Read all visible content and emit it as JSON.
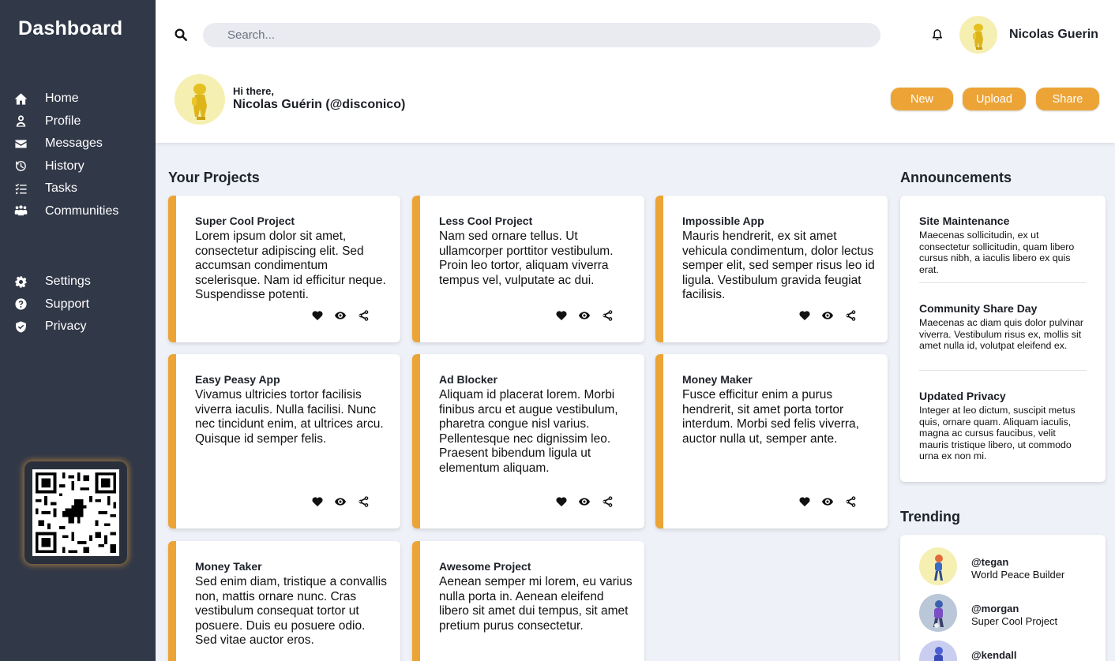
{
  "sidebar": {
    "brand": "Dashboard",
    "primary": [
      {
        "label": "Home",
        "icon": "home-icon"
      },
      {
        "label": "Profile",
        "icon": "profile-icon"
      },
      {
        "label": "Messages",
        "icon": "envelope-icon"
      },
      {
        "label": "History",
        "icon": "history-icon"
      },
      {
        "label": "Tasks",
        "icon": "tasks-icon"
      },
      {
        "label": "Communities",
        "icon": "users-icon"
      }
    ],
    "secondary": [
      {
        "label": "Settings",
        "icon": "gear-icon"
      },
      {
        "label": "Support",
        "icon": "question-icon"
      },
      {
        "label": "Privacy",
        "icon": "shield-icon"
      }
    ]
  },
  "header": {
    "search_placeholder": "Search...",
    "user_name": "Nicolas Guerin",
    "greeting": "Hi there,",
    "full_name": "Nicolas Guérin (@disconico)",
    "buttons": {
      "new": "New",
      "upload": "Upload",
      "share": "Share"
    }
  },
  "projects": {
    "title": "Your Projects",
    "items": [
      {
        "name": "Super Cool Project",
        "desc": "Lorem ipsum dolor sit amet, consectetur adipiscing elit. Sed accumsan condimentum scelerisque. Nam id efficitur neque. Suspendisse potenti."
      },
      {
        "name": "Less Cool Project",
        "desc": "Nam sed ornare tellus. Ut ullamcorper porttitor vestibulum. Proin leo tortor, aliquam viverra tempus vel, vulputate ac dui."
      },
      {
        "name": "Impossible App",
        "desc": "Mauris hendrerit, ex sit amet vehicula condimentum, dolor lectus semper elit, sed semper risus leo id ligula. Vestibulum gravida feugiat facilisis."
      },
      {
        "name": "Easy Peasy App",
        "desc": "Vivamus ultricies tortor facilisis viverra iaculis. Nulla facilisi. Nunc nec tincidunt enim, at ultrices arcu. Quisque id semper felis."
      },
      {
        "name": "Ad Blocker",
        "desc": "Aliquam id placerat lorem. Morbi finibus arcu et augue vestibulum, pharetra congue nisl varius. Pellentesque nec dignissim leo. Praesent bibendum ligula ut elementum aliquam."
      },
      {
        "name": "Money Maker",
        "desc": "Fusce efficitur enim a purus hendrerit, sit amet porta tortor interdum. Morbi sed felis viverra, auctor nulla ut, semper ante."
      },
      {
        "name": "Money Taker",
        "desc": "Sed enim diam, tristique a convallis non, mattis ornare nunc. Cras vestibulum consequat tortor ut posuere. Duis eu posuere odio. Sed vitae auctor eros."
      },
      {
        "name": "Awesome Project",
        "desc": "Aenean semper mi lorem, eu varius nulla porta in. Aenean eleifend libero sit amet dui tempus, sit amet pretium purus consectetur."
      }
    ]
  },
  "announcements": {
    "title": "Announcements",
    "items": [
      {
        "title": "Site Maintenance",
        "body": "Maecenas sollicitudin, ex ut consectetur sollicitudin, quam libero cursus nibh, a iaculis libero ex quis erat."
      },
      {
        "title": "Community Share Day",
        "body": "Maecenas ac diam quis dolor pulvinar viverra. Vestibulum risus ex, mollis sit amet nulla id, volutpat eleifend ex."
      },
      {
        "title": "Updated Privacy",
        "body": "Integer at leo dictum, suscipit metus quis, ornare quam. Aliquam iaculis, magna ac cursus faucibus, velit mauris tristique libero, ut commodo urna ex non mi."
      }
    ]
  },
  "trending": {
    "title": "Trending",
    "items": [
      {
        "handle": "@tegan",
        "project": "World Peace Builder"
      },
      {
        "handle": "@morgan",
        "project": "Super Cool Project"
      },
      {
        "handle": "@kendall",
        "project": ""
      }
    ]
  },
  "colors": {
    "sidebar": "#313848",
    "accent": "#eca437",
    "background": "#eef1f7"
  }
}
